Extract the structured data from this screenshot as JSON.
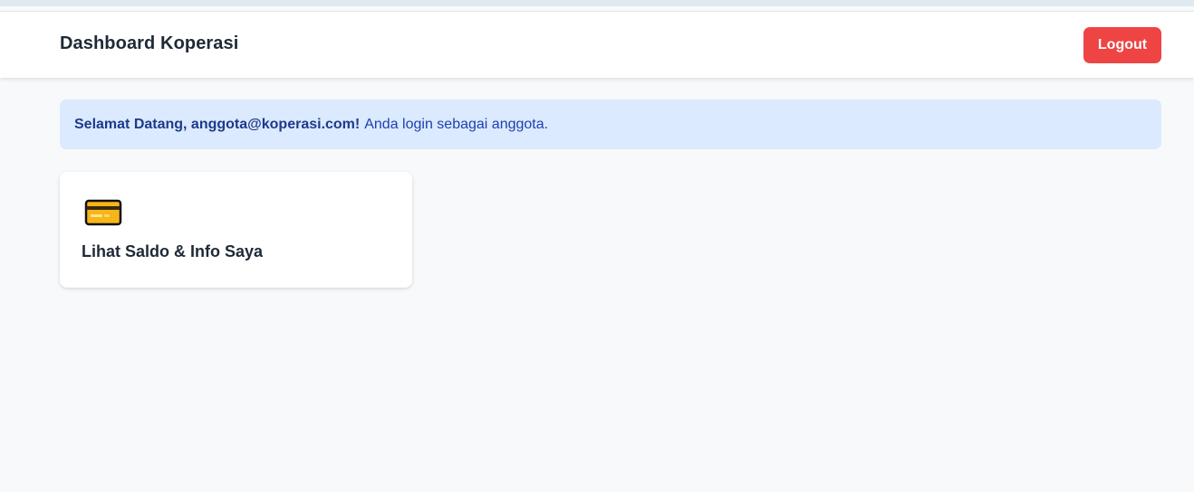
{
  "navbar": {
    "title": "Dashboard Koperasi",
    "logout_label": "Logout"
  },
  "welcome": {
    "greeting": "Selamat Datang, anggota@koperasi.com!",
    "message": "Anda login sebagai anggota."
  },
  "menu_cards": [
    {
      "icon": "credit-card-icon",
      "label": "Lihat Saldo & Info Saya"
    }
  ],
  "colors": {
    "page_background": "#f8f9fb",
    "logout_button": "#ef4444",
    "alert_background": "#dbeafe",
    "alert_text": "#1e40af",
    "card_icon_fill": "#f6b51a"
  }
}
